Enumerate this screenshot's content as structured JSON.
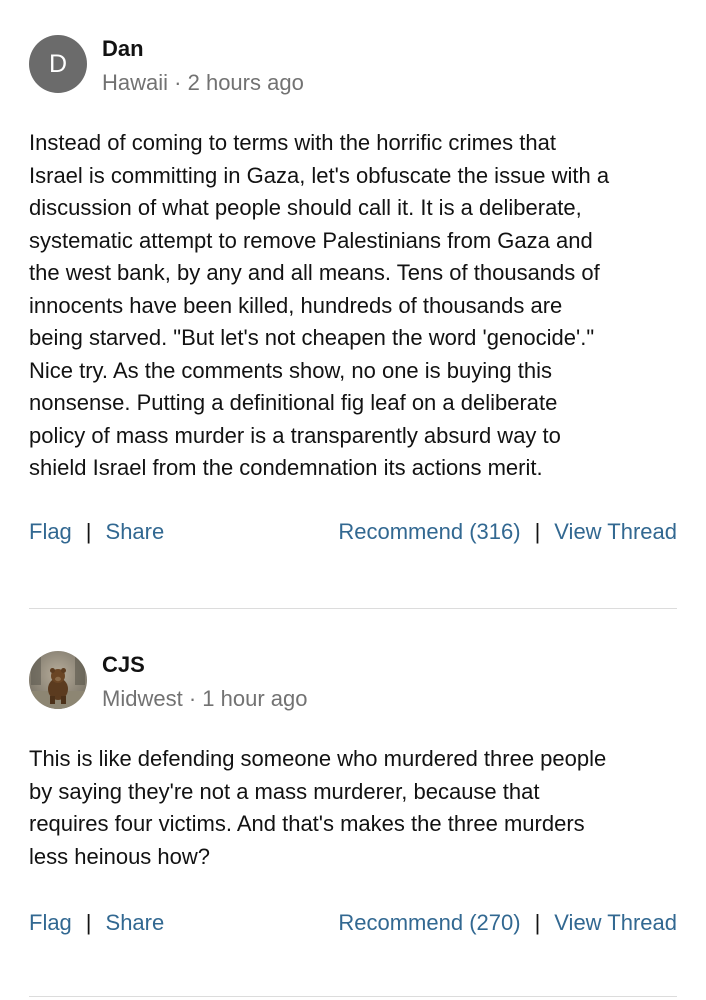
{
  "comments": [
    {
      "avatar_initial": "D",
      "author": "Dan",
      "location": "Hawaii",
      "time": "2 hours ago",
      "body_lines": [
        "Instead of coming to terms with the horrific crimes that",
        "Israel is committing in Gaza, let's obfuscate the issue with a",
        "discussion of what people should call it. It is a deliberate,",
        "systematic attempt to remove Palestinians from Gaza and",
        "the west bank, by any and all means. Tens of thousands of",
        "innocents have been killed, hundreds of thousands are",
        "being starved. \"But let's not cheapen the word 'genocide'.\"",
        "Nice try. As the comments show, no one is buying this",
        "nonsense. Putting a definitional fig leaf on a deliberate",
        "policy of mass murder is a transparently absurd way to",
        "shield Israel from the condemnation its actions merit."
      ],
      "actions": {
        "flag": "Flag",
        "share": "Share",
        "recommend": "Recommend (316)",
        "view_thread": "View Thread"
      }
    },
    {
      "avatar_icon": "bear-photo-avatar",
      "author": "CJS",
      "location": "Midwest",
      "time": "1 hour ago",
      "body_lines": [
        "This is like defending someone who murdered three people",
        "by saying they're not a mass murderer, because that",
        "requires four victims. And that's makes the three murders",
        "less heinous how?"
      ],
      "actions": {
        "flag": "Flag",
        "share": "Share",
        "recommend": "Recommend (270)",
        "view_thread": "View Thread"
      }
    }
  ],
  "meta_separator": "·",
  "action_separator": "|",
  "colors": {
    "link": "#326891",
    "meta": "#727272",
    "text": "#121212",
    "divider": "#dcdcdc",
    "avatar_bg": "#6b6b6b"
  }
}
